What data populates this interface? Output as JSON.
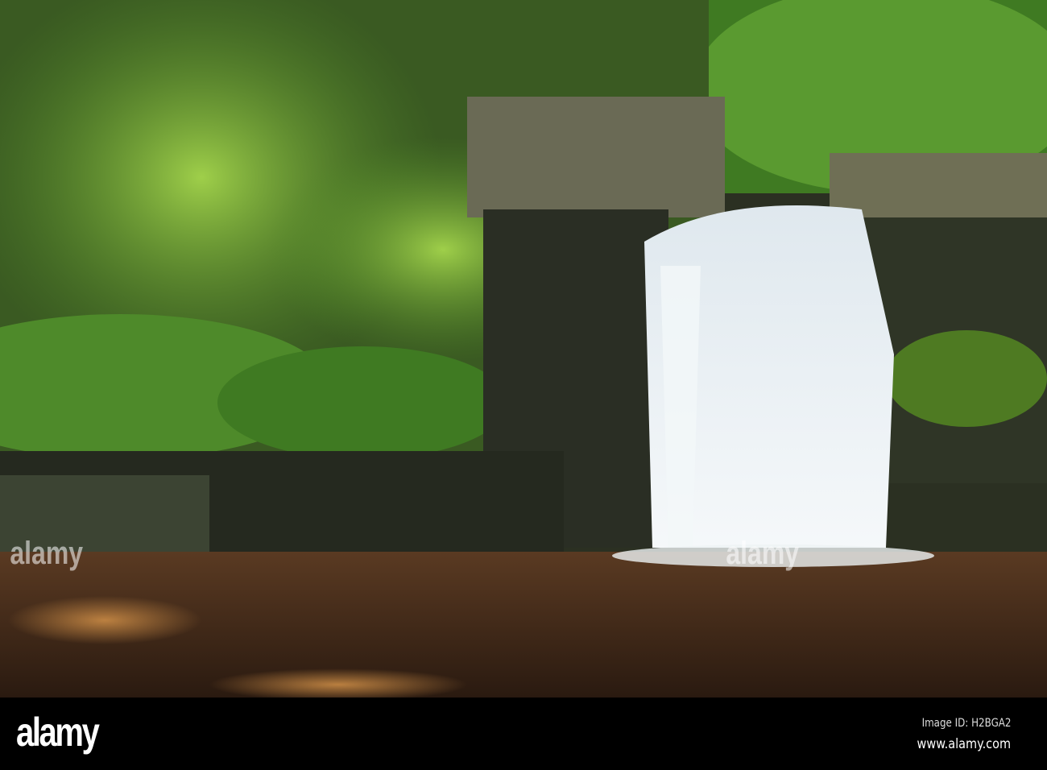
{
  "photo": {
    "subject": "waterfall",
    "colors": {
      "foliage": "#5f9a2c",
      "rock": "#2d3324",
      "water": "#4a2c1a",
      "falls": "#e8eef2"
    }
  },
  "watermark": {
    "text": "alamy"
  },
  "footer": {
    "logo": "alamy",
    "image_id": "Image ID: H2BGA2",
    "website": "www.alamy.com"
  }
}
